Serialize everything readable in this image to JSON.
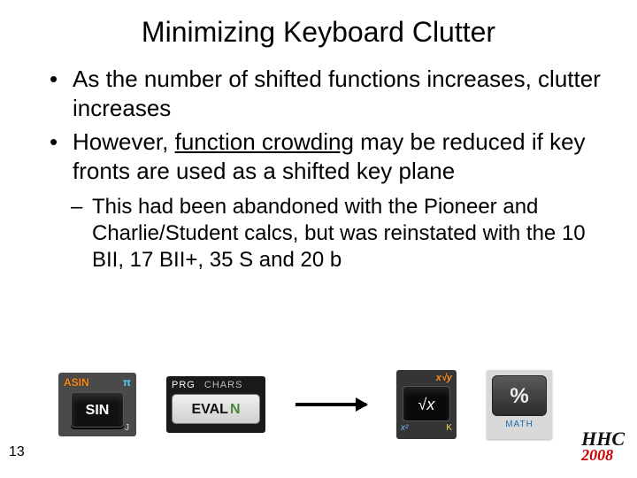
{
  "title": "Minimizing Keyboard Clutter",
  "bullets": {
    "b1a": "As the number of shifted functions increases, clutter increases",
    "b1b_pre": "However, ",
    "b1b_u": "function crowding",
    "b1b_post": " may be reduced if key fronts are used as a shifted key plane",
    "b2": "This had been abandoned with the Pioneer and Charlie/Student calcs, but was reinstated with the 10 BII, 17 BII+, 35 S and 20 b"
  },
  "keys": {
    "k1": {
      "shift_left": "ASIN",
      "shift_right": "π",
      "main": "SIN",
      "front": "J"
    },
    "k2": {
      "shift_left": "PRG",
      "shift_right": "CHARS",
      "main": "EVAL",
      "main_suffix": "N"
    },
    "k3": {
      "shift_top": "x√y",
      "main": "√x",
      "shift_bl": "x²",
      "shift_br": "K"
    },
    "k4": {
      "main": "%",
      "front": "MATH"
    }
  },
  "page_number": "13",
  "logo": {
    "line1": "HHC",
    "line2": "2008"
  }
}
